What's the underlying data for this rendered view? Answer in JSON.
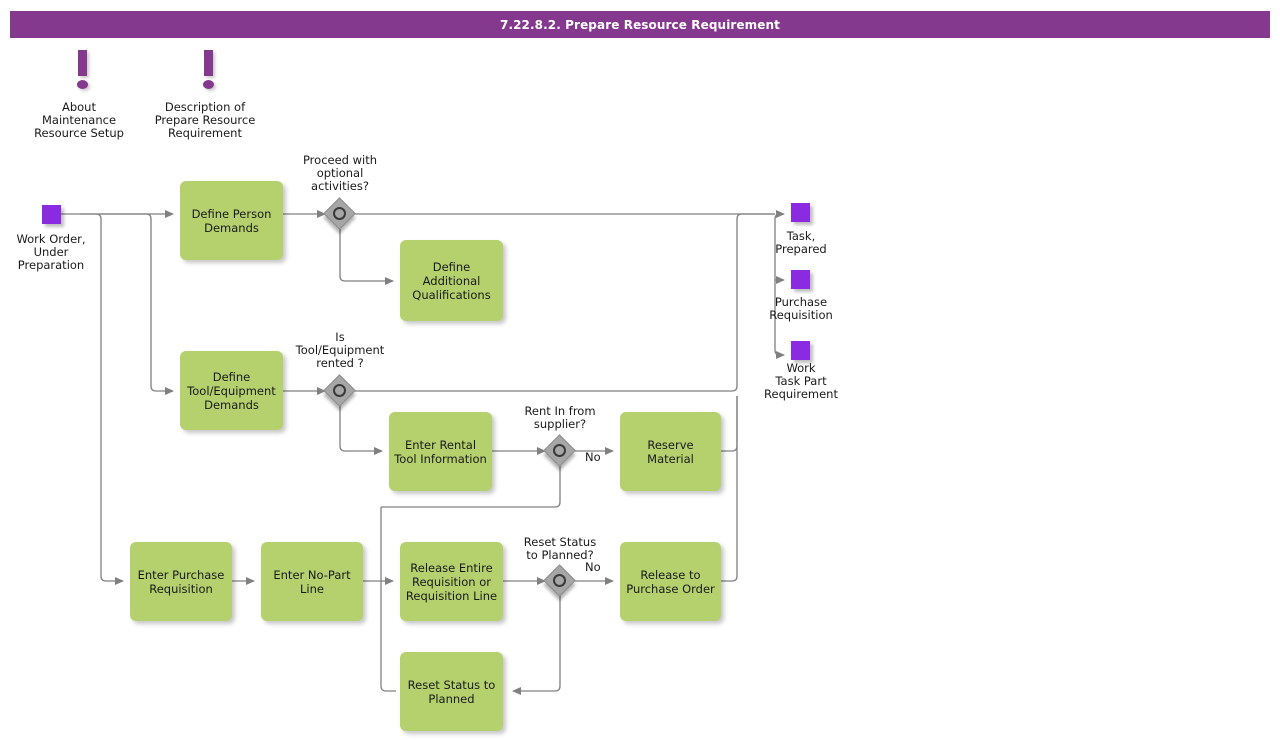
{
  "header": {
    "title": "7.22.8.2. Prepare Resource Requirement",
    "bar_color": "#84398e",
    "text_color": "#ffffff"
  },
  "palette": {
    "task_fill": "#b5d16e",
    "event_fill": "#8a2be2",
    "gateway_fill": "#a6a6a6",
    "gateway_ring": "#3a3a3a",
    "connector": "#808080",
    "note_accent": "#84398e"
  },
  "notes": [
    {
      "icon": "exclamation-icon",
      "label": "About\nMaintenance\nResource Setup"
    },
    {
      "icon": "exclamation-icon",
      "label": "Description of\nPrepare Resource\nRequirement"
    }
  ],
  "start_events": [
    {
      "name": "work-order-under-preparation",
      "label": "Work Order,\nUnder\nPreparation"
    }
  ],
  "end_events": [
    {
      "name": "task-prepared",
      "label": "Task,\nPrepared"
    },
    {
      "name": "purchase-requisition",
      "label": "Purchase\nRequisition"
    },
    {
      "name": "work-task-part-requirement",
      "label": "Work\nTask Part\nRequirement"
    }
  ],
  "tasks": [
    {
      "name": "define-person-demands",
      "label": "Define Person\nDemands"
    },
    {
      "name": "define-additional-qualifications",
      "label": "Define\nAdditional\nQualifications"
    },
    {
      "name": "define-tool-equipment-demands",
      "label": "Define\nTool/Equipment\nDemands"
    },
    {
      "name": "enter-rental-tool-information",
      "label": "Enter Rental\nTool Information"
    },
    {
      "name": "reserve-material",
      "label": "Reserve Material"
    },
    {
      "name": "enter-purchase-requisition",
      "label": "Enter Purchase\nRequisition"
    },
    {
      "name": "enter-no-part-line",
      "label": "Enter No-Part\nLine"
    },
    {
      "name": "release-entire-requisition-or-requisition-line",
      "label": "Release Entire\nRequisition or\nRequisition Line"
    },
    {
      "name": "release-to-purchase-order",
      "label": "Release to\nPurchase Order"
    },
    {
      "name": "reset-status-to-planned-task",
      "label": "Reset Status to\nPlanned"
    }
  ],
  "gateways": [
    {
      "name": "gateway-proceed-optional",
      "label": "Proceed with\noptional\nactivities?"
    },
    {
      "name": "gateway-tool-rented",
      "label": "Is\nTool/Equipment\nrented ?"
    },
    {
      "name": "gateway-rent-in-supplier",
      "label": "Rent In from\nsupplier?"
    },
    {
      "name": "gateway-reset-status-planned",
      "label": "Reset Status\nto Planned?"
    }
  ],
  "edge_labels": [
    {
      "name": "edge-label-rent-no",
      "label": "No"
    },
    {
      "name": "edge-label-reset-no",
      "label": "No"
    }
  ]
}
